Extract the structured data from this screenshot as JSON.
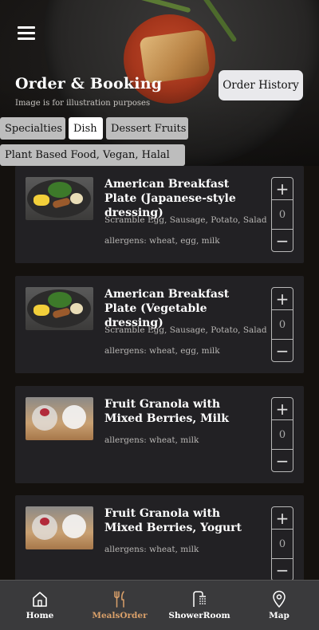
{
  "header": {
    "title": "Order & Booking",
    "subtitle": "Image is for illustration purposes",
    "order_history_label": "Order History"
  },
  "tabs": [
    {
      "label": "Specialties",
      "active": false
    },
    {
      "label": "Dish",
      "active": true
    },
    {
      "label": "Dessert Fruits",
      "active": false
    },
    {
      "label": "Plant Based Food, Vegan, Halal",
      "active": false
    }
  ],
  "items": [
    {
      "title": "American Breakfast Plate (Japanese-style dressing)",
      "description": "Scramble Egg, Sausage, Potato, Salad",
      "allergens": "allergens: wheat, egg, milk",
      "quantity": "0",
      "image": "breakfast-plate"
    },
    {
      "title": "American Breakfast Plate (Vegetable dressing)",
      "description": "Scramble Egg, Sausage, Potato, Salad",
      "allergens": "allergens: wheat, egg, milk",
      "quantity": "0",
      "image": "breakfast-plate"
    },
    {
      "title": "Fruit Granola with Mixed Berries, Milk",
      "description": "",
      "allergens": "allergens: wheat, milk",
      "quantity": "0",
      "image": "granola"
    },
    {
      "title": "Fruit Granola with Mixed Berries, Yogurt",
      "description": "",
      "allergens": "allergens: wheat, milk",
      "quantity": "0",
      "image": "granola"
    }
  ],
  "stepper": {
    "plus": "+",
    "minus": "−"
  },
  "nav": [
    {
      "label": "Home",
      "icon": "home-icon",
      "active": false
    },
    {
      "label": "MealsOrder",
      "icon": "cutlery-icon",
      "active": true
    },
    {
      "label": "ShowerRoom",
      "icon": "shower-icon",
      "active": false
    },
    {
      "label": "Map",
      "icon": "map-pin-icon",
      "active": false
    }
  ],
  "colors": {
    "accent": "#d9a06a",
    "card": "#222124",
    "nav_bg": "#3a3a3c"
  }
}
